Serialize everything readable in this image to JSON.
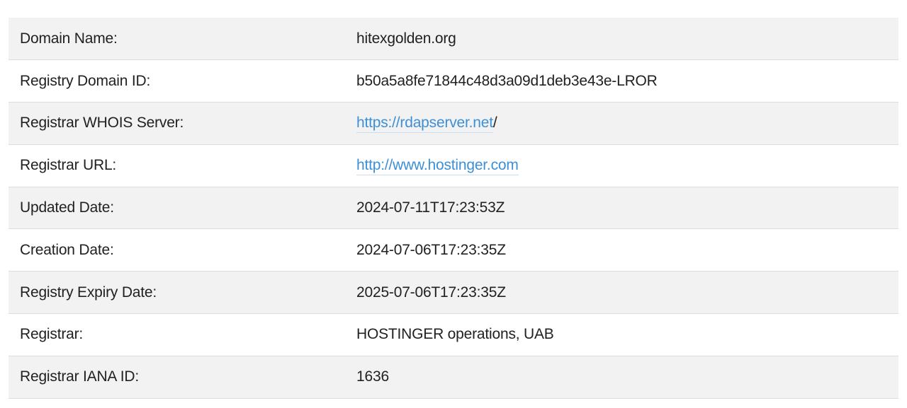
{
  "whois": {
    "rows": [
      {
        "label": "Domain Name:",
        "value": "hitexgolden.org"
      },
      {
        "label": "Registry Domain ID:",
        "value": "b50a5a8fe71844c48d3a09d1deb3e43e-LROR"
      },
      {
        "label": "Registrar WHOIS Server:",
        "link": "https://rdapserver.net",
        "suffix": "/"
      },
      {
        "label": "Registrar URL:",
        "link": "http://www.hostinger.com"
      },
      {
        "label": "Updated Date:",
        "value": "2024-07-11T17:23:53Z"
      },
      {
        "label": "Creation Date:",
        "value": "2024-07-06T17:23:35Z"
      },
      {
        "label": "Registry Expiry Date:",
        "value": "2025-07-06T17:23:35Z"
      },
      {
        "label": "Registrar:",
        "value": "HOSTINGER operations, UAB"
      },
      {
        "label": "Registrar IANA ID:",
        "value": "1636"
      }
    ]
  },
  "colors": {
    "link": "#3d8fd6",
    "row_shade": "#f2f2f2",
    "divider": "#dcdcdc"
  }
}
